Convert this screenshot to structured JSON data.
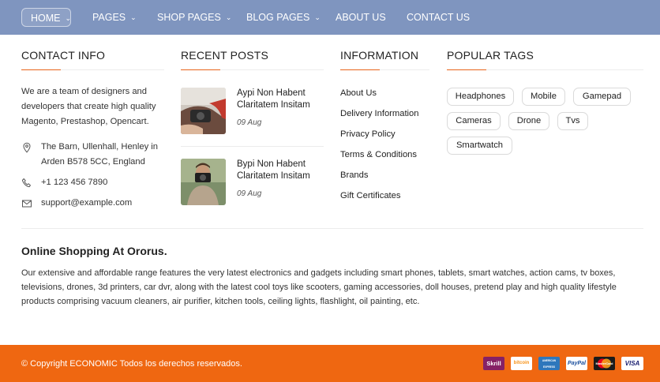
{
  "nav": {
    "items": [
      {
        "label": "HOME",
        "dropdown": true
      },
      {
        "label": "PAGES",
        "dropdown": true
      },
      {
        "label": "SHOP PAGES",
        "dropdown": true
      },
      {
        "label": "BLOG PAGES",
        "dropdown": true
      },
      {
        "label": "ABOUT US",
        "dropdown": false
      },
      {
        "label": "CONTACT US",
        "dropdown": false
      }
    ],
    "active": "HOME",
    "bg_color": "#7f95bf"
  },
  "contact": {
    "title": "CONTACT INFO",
    "intro_lines": [
      "We are a team of designers and",
      "developers that create high quality",
      "Magento, Prestashop, Opencart."
    ],
    "address_lines": [
      "The Barn, Ullenhall, Henley in",
      "Arden B578 5CC, England"
    ],
    "phone": "+1 123 456 7890",
    "email": "support@example.com"
  },
  "recent_posts": {
    "title": "RECENT POSTS",
    "posts": [
      {
        "title_lines": [
          "Aypi Non Habent",
          "Claritatem Insitam"
        ],
        "date": "09 Aug"
      },
      {
        "title_lines": [
          "Bypi Non Habent",
          "Claritatem Insitam"
        ],
        "date": "09 Aug"
      }
    ]
  },
  "information": {
    "title": "INFORMATION",
    "links": [
      "About Us",
      "Delivery Information",
      "Privacy Policy",
      "Terms & Conditions",
      "Brands",
      "Gift Certificates"
    ]
  },
  "popular_tags": {
    "title": "POPULAR TAGS",
    "tags": [
      "Headphones",
      "Mobile",
      "Gamepad",
      "Cameras",
      "Drone",
      "Tvs",
      "Smartwatch"
    ]
  },
  "about": {
    "title": "Online Shopping At Ororus.",
    "lines": [
      "Our extensive and affordable range features the very latest electronics and gadgets including smart phones, tablets, smart watches, action cams, tv boxes,",
      "televisions, drones, 3d printers, car dvr, along with the latest cool toys like scooters, gaming accessories, doll houses, pretend play and high quality lifestyle",
      "products comprising vacuum cleaners, air purifier, kitchen tools, ceiling lights, flashlight, oil painting, etc."
    ]
  },
  "footer": {
    "copyright": "© Copyright ECONOMIC Todos los derechos reservados.",
    "payments": [
      "Skrill",
      "bitcoin",
      "AMERICAN EXPRESS",
      "PayPal",
      "MasterCard",
      "VISA"
    ],
    "bg_color": "#ef6711"
  },
  "colors": {
    "accent": "#e8631a"
  }
}
